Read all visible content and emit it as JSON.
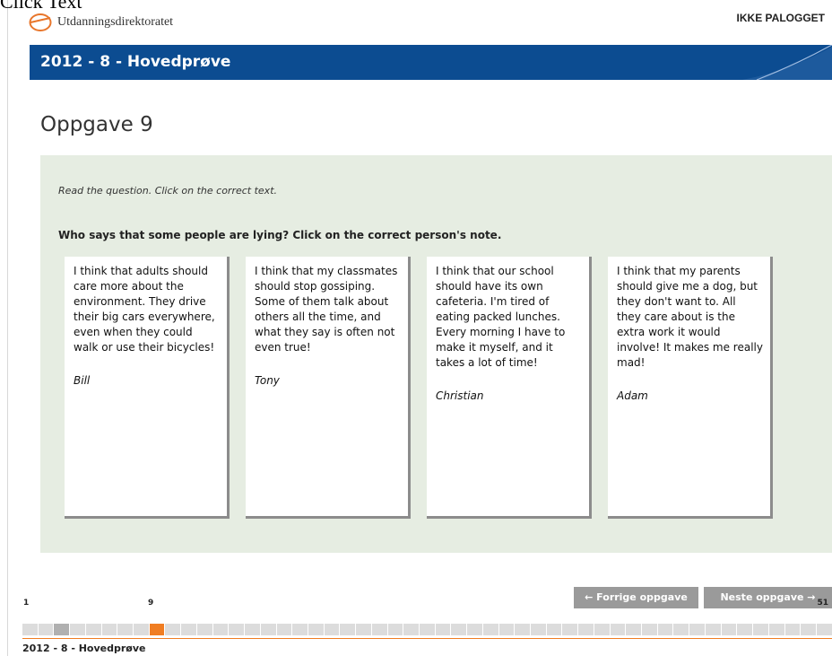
{
  "caption": "Click Text",
  "header": {
    "org_name": "Utdanningsdirektoratet",
    "login_status": "IKKE PALOGGET"
  },
  "banner": {
    "title": "2012 - 8 - Hovedprøve"
  },
  "task": {
    "title": "Oppgave 9",
    "instruction": "Read the question. Click on the correct text.",
    "question": "Who says that some people are lying? Click on the correct person's note.",
    "notes": [
      {
        "text": "I think that adults should care more about the environment. They drive their big cars everywhere, even when they could walk or use their bicycles!",
        "author": "Bill"
      },
      {
        "text": "I think that my classmates should stop gossiping. Some of them talk about others all the time, and what they say is often not even true!",
        "author": "Tony"
      },
      {
        "text": "I think that our school should have its own cafeteria. I'm tired of eating packed lunches. Every morning I have to make it myself, and it takes a lot of time!",
        "author": "Christian"
      },
      {
        "text": "I think that my parents should give me a dog, but they don't want to. All they care about is the extra work it would involve! It makes me really mad!",
        "author": "Adam"
      }
    ]
  },
  "nav": {
    "prev_label": "← Forrige oppgave",
    "next_label": "Neste oppgave  →"
  },
  "progress": {
    "first": "1",
    "current": "9",
    "last": "51",
    "total": 51,
    "current_index": 9,
    "visited": [
      3
    ]
  },
  "footer": {
    "title": "2012 - 8 - Hovedprøve"
  },
  "colors": {
    "banner": "#0c4c91",
    "accent": "#f07d22",
    "panel": "#e6ede2",
    "button": "#9a9a9a"
  }
}
